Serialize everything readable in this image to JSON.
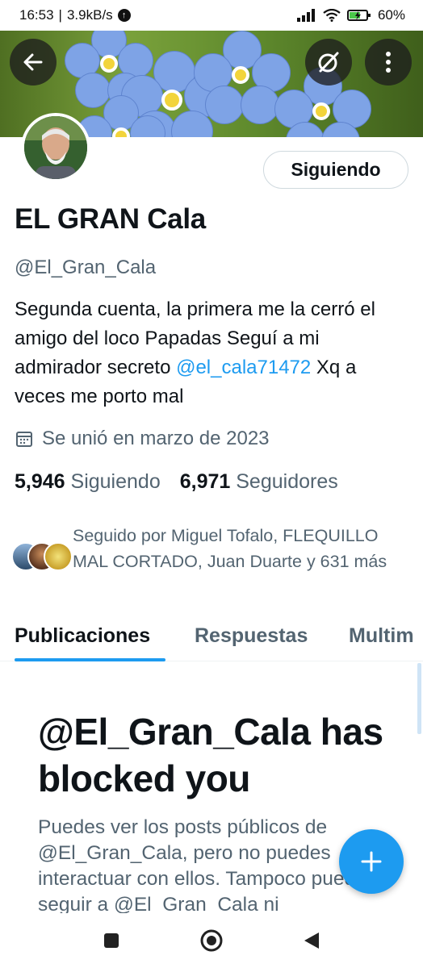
{
  "status_bar": {
    "time": "16:53",
    "network_speed": "3.9kB/s",
    "battery": "60%"
  },
  "header": {
    "back_icon": "arrow-left-icon",
    "grok_icon": "slashed-circle-icon",
    "more_icon": "vertical-dots-icon"
  },
  "profile": {
    "follow_button": "Siguiendo",
    "name": "EL GRAN Cala",
    "handle": "@El_Gran_Cala",
    "bio_part1": "Segunda cuenta, la primera me la cerró el amigo del loco Papadas Seguí a mi admirador secreto ",
    "bio_mention": "@el_cala71472",
    "bio_part2": " Xq a veces me porto mal",
    "joined": "Se unió en marzo de 2023",
    "following_count": "5,946",
    "following_label": "Siguiendo",
    "followers_count": "6,971",
    "followers_label": "Seguidores",
    "followed_by": "Seguido por Miguel Tofalo, FLEQUILLO MAL CORTADO, Juan Duarte y 631 más"
  },
  "tabs": [
    {
      "label": "Publicaciones"
    },
    {
      "label": "Respuestas"
    },
    {
      "label": "Multim"
    }
  ],
  "blocked": {
    "title": "@El_Gran_Cala has blocked you",
    "message": "Puedes ver los posts públicos de @El_Gran_Cala, pero no puedes interactuar con ellos. Tampoco puedes seguir a @El_Gran_Cala ni"
  },
  "fab": {
    "icon": "plus-icon"
  },
  "nav": {
    "recents_icon": "square-icon",
    "home_icon": "circle-home-icon",
    "back_icon": "triangle-back-icon"
  },
  "colors": {
    "accent": "#1d9bf0",
    "secondary_text": "#536471"
  }
}
